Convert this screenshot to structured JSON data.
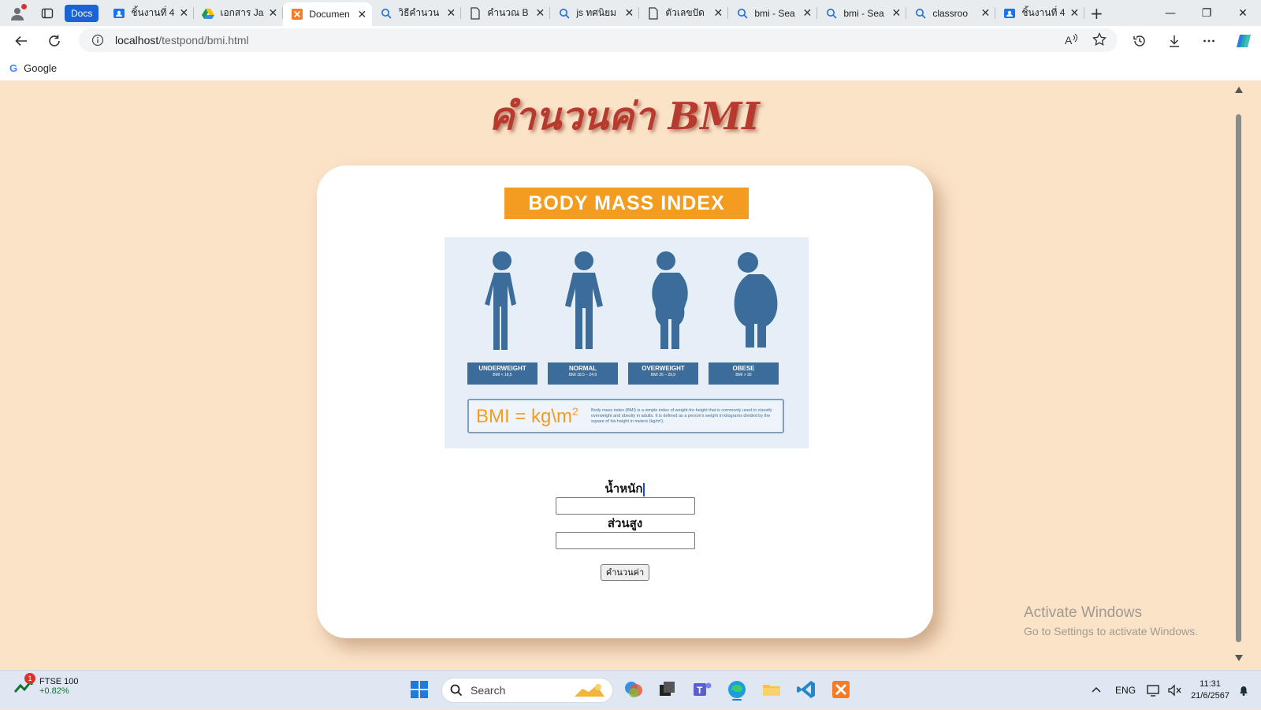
{
  "browser": {
    "docs_chip": "Docs",
    "tabs": [
      {
        "title": "ชิ้นงานที่ 4",
        "icon": "classroom-icon"
      },
      {
        "title": "เอกสาร Ja",
        "icon": "drive-icon"
      },
      {
        "title": "Documen",
        "icon": "xampp-icon",
        "active": true
      },
      {
        "title": "วิธีคำนวน",
        "icon": "search-icon"
      },
      {
        "title": "คำนวณ B",
        "icon": "document-icon"
      },
      {
        "title": "js ทศนิยม",
        "icon": "search-icon"
      },
      {
        "title": "ตัวเลขปัด",
        "icon": "document-icon"
      },
      {
        "title": "bmi - Sea",
        "icon": "search-icon"
      },
      {
        "title": "bmi - Sea",
        "icon": "search-icon"
      },
      {
        "title": "classroo",
        "icon": "search-icon"
      },
      {
        "title": "ชิ้นงานที่ 4",
        "icon": "classroom-icon"
      }
    ],
    "url_host": "localhost",
    "url_path": "/testpond/bmi.html",
    "bookmark": "Google"
  },
  "page": {
    "title": "คำนวนค่า BMI",
    "banner": "BODY MASS INDEX",
    "figures": [
      {
        "name": "UNDERWEIGHT",
        "range": "BMI < 18,5"
      },
      {
        "name": "NORMAL",
        "range": "BMI 18,5 – 24,9"
      },
      {
        "name": "OVERWEIGHT",
        "range": "BMI 25 – 29,9"
      },
      {
        "name": "OBESE",
        "range": "BMI > 30"
      }
    ],
    "formula_text": "BMI = kg\\m",
    "formula_sup": "2",
    "formula_desc": "Body mass index (BMI) is a simple index of weight-for-height that is commonly used to classify overweight and obesity in adults. It is defined as a person's weight in kilograms divided by the square of his height in meters (kg/m²).",
    "weight_label": "น้ำหนัก",
    "weight_value": "",
    "height_label": "ส่วนสูง",
    "height_value": "",
    "submit_label": "คำนวนค่า"
  },
  "watermark": {
    "line1": "Activate Windows",
    "line2": "Go to Settings to activate Windows."
  },
  "taskbar": {
    "widget_badge": "1",
    "widget_title": "FTSE 100",
    "widget_value": "+0.82%",
    "search_placeholder": "Search",
    "lang": "ENG",
    "time": "11:31",
    "date": "21/6/2567"
  }
}
